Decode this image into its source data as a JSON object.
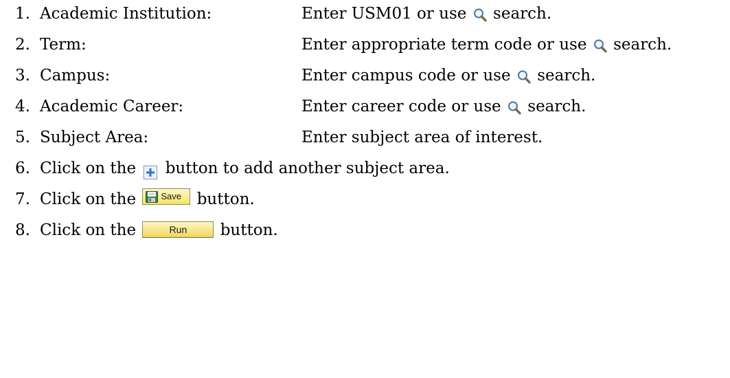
{
  "steps": [
    {
      "num": "1.",
      "label": "Academic Institution:",
      "value_before": "Enter USM01 or use",
      "icon": "magnifier-search-icon",
      "value_after": "search."
    },
    {
      "num": "2.",
      "label": "Term:",
      "value_before": "Enter appropriate term code or use",
      "icon": "magnifier-search-icon",
      "value_after": "search."
    },
    {
      "num": "3.",
      "label": "Campus:",
      "value_before": "Enter campus code or use",
      "icon": "magnifier-search-icon",
      "value_after": "search."
    },
    {
      "num": "4.",
      "label": "Academic Career:",
      "value_before": "Enter career code or use",
      "icon": "magnifier-search-icon",
      "value_after": "search."
    },
    {
      "num": "5.",
      "label": "Subject Area:",
      "value": "Enter subject area of interest."
    },
    {
      "num": "6.",
      "text_before": "Click on the",
      "icon": "plus-add-icon",
      "text_after": "button to add another subject area."
    },
    {
      "num": "7.",
      "text_before": "Click on the",
      "button_label": "Save",
      "text_after": "button."
    },
    {
      "num": "8.",
      "text_before": "Click on the",
      "button_label": "Run",
      "text_after": "button."
    }
  ],
  "colors": {
    "text": "#000000",
    "button_fill_top": "#fff7c2",
    "button_fill_bottom": "#f0d760",
    "button_border": "#8c8c5a",
    "plus_icon_blue": "#2f6fd6"
  }
}
